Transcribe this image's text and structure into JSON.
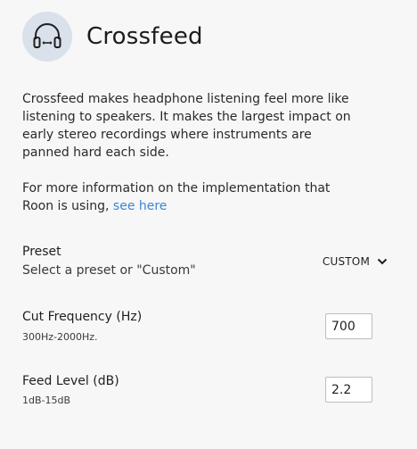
{
  "header": {
    "title": "Crossfeed",
    "icon": "headphones-crossfeed-icon"
  },
  "description": {
    "paragraph1": "Crossfeed makes headphone listening feel more like listening to speakers. It makes the largest impact on early stereo recordings where instruments are panned hard each side.",
    "paragraph2_text": "For more information on the implementation that Roon is using, ",
    "paragraph2_link": "see here"
  },
  "preset": {
    "label": "Preset",
    "hint": "Select a preset or \"Custom\"",
    "selected": "CUSTOM"
  },
  "cut_frequency": {
    "label": "Cut Frequency (Hz)",
    "range": "300Hz-2000Hz.",
    "value": "700"
  },
  "feed_level": {
    "label": "Feed Level (dB)",
    "range": "1dB-15dB",
    "value": "2.2"
  },
  "colors": {
    "accent_link": "#3a86d6",
    "icon_circle": "#d9e1ea",
    "background": "#f7f7f7"
  }
}
